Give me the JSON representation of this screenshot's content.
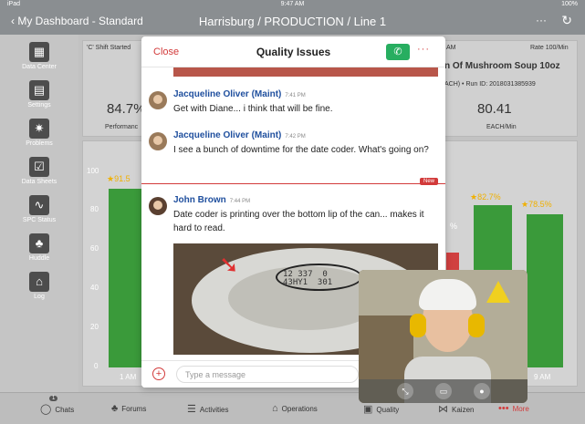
{
  "status_bar": {
    "left": "iPad",
    "time": "9:47 AM",
    "right": "100%"
  },
  "header": {
    "back_label": "My Dashboard - Standard",
    "title": "Harrisburg / PRODUCTION / Line 1",
    "more_label": "···",
    "refresh_label": "↻"
  },
  "sidebar": {
    "items": [
      {
        "label": "Data Center",
        "icon": "database-icon"
      },
      {
        "label": "Settings",
        "icon": "clipboard-icon"
      },
      {
        "label": "Problems",
        "icon": "burst-icon"
      },
      {
        "label": "Data Sheets",
        "icon": "checklist-icon"
      },
      {
        "label": "SPC Status",
        "icon": "spc-chart-icon"
      },
      {
        "label": "Huddle",
        "icon": "people-icon"
      },
      {
        "label": "Log",
        "icon": "factory-icon"
      }
    ]
  },
  "dashboard": {
    "shift_label": "'C' Shift Started",
    "performance_value": "84.7%",
    "performance_label": "Performanc",
    "rate_label": "Rate 100/Min",
    "product": "n Of Mushroom Soup 10oz",
    "run_id": "ACH) • Run ID: 2018031385939",
    "rate_value": "80.41",
    "rate_unit": "EACH/Min",
    "y_ticks": [
      "100",
      "80",
      "60",
      "40",
      "20",
      "0"
    ],
    "bar_labels": [
      "★91.5",
      "★82.7%",
      "★78.5%"
    ],
    "x_labels": [
      "1 AM",
      "9 AM"
    ],
    "partial_label": "%"
  },
  "chat": {
    "close_label": "Close",
    "title": "Quality Issues",
    "call_icon": "phone-icon",
    "more_label": "···",
    "messages": [
      {
        "author": "Jacqueline Oliver (Maint)",
        "time": "7:41 PM",
        "text": "Get with Diane... i think that will be fine."
      },
      {
        "author": "Jacqueline Oliver (Maint)",
        "time": "7:42 PM",
        "text": "I see a bunch of downtime for the date coder. What's going on?"
      },
      {
        "author": "John Brown",
        "time": "7:44 PM",
        "text": "Date coder is printing over the bottom lip of the can... makes it hard to read."
      }
    ],
    "new_badge": "New",
    "photo_code": "12 337  0\n43HY1  301",
    "composer_placeholder": "Type a message"
  },
  "video": {
    "buttons": [
      "expand-icon",
      "camera-icon",
      "mic-icon"
    ]
  },
  "tabbar": {
    "items": [
      {
        "label": "Chats",
        "icon": "chat-icon",
        "badge": "1"
      },
      {
        "label": "Forums",
        "icon": "people-icon"
      },
      {
        "label": "Activities",
        "icon": "checklist-icon"
      },
      {
        "label": "Operations",
        "icon": "factory-icon"
      },
      {
        "label": "Quality",
        "icon": "quality-icon"
      },
      {
        "label": "Kaizen",
        "icon": "kaizen-icon"
      },
      {
        "label": "More",
        "icon": "more-icon"
      }
    ],
    "active_color": "#d23a3a"
  }
}
